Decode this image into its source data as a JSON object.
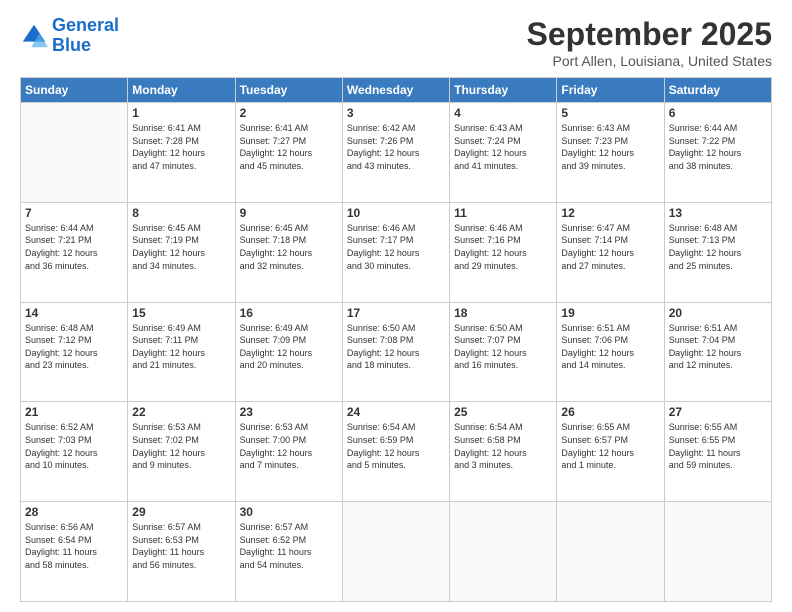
{
  "header": {
    "logo_line1": "General",
    "logo_line2": "Blue",
    "title": "September 2025",
    "subtitle": "Port Allen, Louisiana, United States"
  },
  "days_of_week": [
    "Sunday",
    "Monday",
    "Tuesday",
    "Wednesday",
    "Thursday",
    "Friday",
    "Saturday"
  ],
  "weeks": [
    [
      {
        "day": "",
        "info": ""
      },
      {
        "day": "1",
        "info": "Sunrise: 6:41 AM\nSunset: 7:28 PM\nDaylight: 12 hours\nand 47 minutes."
      },
      {
        "day": "2",
        "info": "Sunrise: 6:41 AM\nSunset: 7:27 PM\nDaylight: 12 hours\nand 45 minutes."
      },
      {
        "day": "3",
        "info": "Sunrise: 6:42 AM\nSunset: 7:26 PM\nDaylight: 12 hours\nand 43 minutes."
      },
      {
        "day": "4",
        "info": "Sunrise: 6:43 AM\nSunset: 7:24 PM\nDaylight: 12 hours\nand 41 minutes."
      },
      {
        "day": "5",
        "info": "Sunrise: 6:43 AM\nSunset: 7:23 PM\nDaylight: 12 hours\nand 39 minutes."
      },
      {
        "day": "6",
        "info": "Sunrise: 6:44 AM\nSunset: 7:22 PM\nDaylight: 12 hours\nand 38 minutes."
      }
    ],
    [
      {
        "day": "7",
        "info": "Sunrise: 6:44 AM\nSunset: 7:21 PM\nDaylight: 12 hours\nand 36 minutes."
      },
      {
        "day": "8",
        "info": "Sunrise: 6:45 AM\nSunset: 7:19 PM\nDaylight: 12 hours\nand 34 minutes."
      },
      {
        "day": "9",
        "info": "Sunrise: 6:45 AM\nSunset: 7:18 PM\nDaylight: 12 hours\nand 32 minutes."
      },
      {
        "day": "10",
        "info": "Sunrise: 6:46 AM\nSunset: 7:17 PM\nDaylight: 12 hours\nand 30 minutes."
      },
      {
        "day": "11",
        "info": "Sunrise: 6:46 AM\nSunset: 7:16 PM\nDaylight: 12 hours\nand 29 minutes."
      },
      {
        "day": "12",
        "info": "Sunrise: 6:47 AM\nSunset: 7:14 PM\nDaylight: 12 hours\nand 27 minutes."
      },
      {
        "day": "13",
        "info": "Sunrise: 6:48 AM\nSunset: 7:13 PM\nDaylight: 12 hours\nand 25 minutes."
      }
    ],
    [
      {
        "day": "14",
        "info": "Sunrise: 6:48 AM\nSunset: 7:12 PM\nDaylight: 12 hours\nand 23 minutes."
      },
      {
        "day": "15",
        "info": "Sunrise: 6:49 AM\nSunset: 7:11 PM\nDaylight: 12 hours\nand 21 minutes."
      },
      {
        "day": "16",
        "info": "Sunrise: 6:49 AM\nSunset: 7:09 PM\nDaylight: 12 hours\nand 20 minutes."
      },
      {
        "day": "17",
        "info": "Sunrise: 6:50 AM\nSunset: 7:08 PM\nDaylight: 12 hours\nand 18 minutes."
      },
      {
        "day": "18",
        "info": "Sunrise: 6:50 AM\nSunset: 7:07 PM\nDaylight: 12 hours\nand 16 minutes."
      },
      {
        "day": "19",
        "info": "Sunrise: 6:51 AM\nSunset: 7:06 PM\nDaylight: 12 hours\nand 14 minutes."
      },
      {
        "day": "20",
        "info": "Sunrise: 6:51 AM\nSunset: 7:04 PM\nDaylight: 12 hours\nand 12 minutes."
      }
    ],
    [
      {
        "day": "21",
        "info": "Sunrise: 6:52 AM\nSunset: 7:03 PM\nDaylight: 12 hours\nand 10 minutes."
      },
      {
        "day": "22",
        "info": "Sunrise: 6:53 AM\nSunset: 7:02 PM\nDaylight: 12 hours\nand 9 minutes."
      },
      {
        "day": "23",
        "info": "Sunrise: 6:53 AM\nSunset: 7:00 PM\nDaylight: 12 hours\nand 7 minutes."
      },
      {
        "day": "24",
        "info": "Sunrise: 6:54 AM\nSunset: 6:59 PM\nDaylight: 12 hours\nand 5 minutes."
      },
      {
        "day": "25",
        "info": "Sunrise: 6:54 AM\nSunset: 6:58 PM\nDaylight: 12 hours\nand 3 minutes."
      },
      {
        "day": "26",
        "info": "Sunrise: 6:55 AM\nSunset: 6:57 PM\nDaylight: 12 hours\nand 1 minute."
      },
      {
        "day": "27",
        "info": "Sunrise: 6:55 AM\nSunset: 6:55 PM\nDaylight: 11 hours\nand 59 minutes."
      }
    ],
    [
      {
        "day": "28",
        "info": "Sunrise: 6:56 AM\nSunset: 6:54 PM\nDaylight: 11 hours\nand 58 minutes."
      },
      {
        "day": "29",
        "info": "Sunrise: 6:57 AM\nSunset: 6:53 PM\nDaylight: 11 hours\nand 56 minutes."
      },
      {
        "day": "30",
        "info": "Sunrise: 6:57 AM\nSunset: 6:52 PM\nDaylight: 11 hours\nand 54 minutes."
      },
      {
        "day": "",
        "info": ""
      },
      {
        "day": "",
        "info": ""
      },
      {
        "day": "",
        "info": ""
      },
      {
        "day": "",
        "info": ""
      }
    ]
  ]
}
